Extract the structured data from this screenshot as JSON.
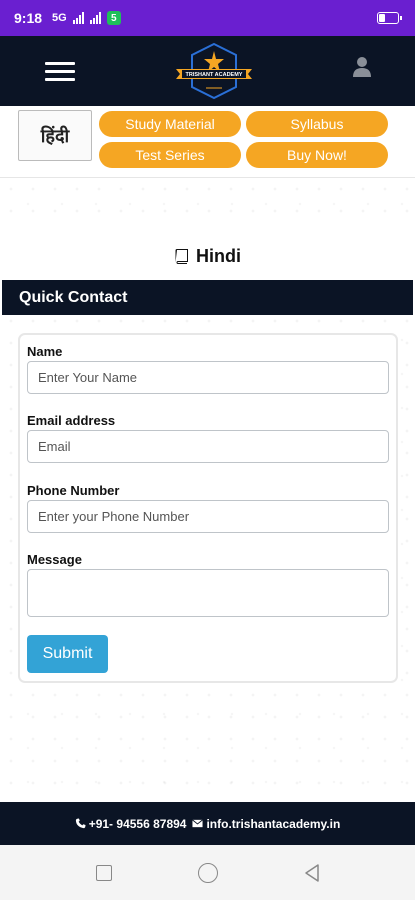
{
  "status_bar": {
    "time": "9:18",
    "carrier": "5G",
    "app_badge": "5",
    "battery_level": 0.3
  },
  "header": {
    "logo_text": "TRISHANT ACADEMY",
    "menu_icon": "hamburger-menu-icon",
    "user_icon": "user-icon"
  },
  "subnav": {
    "thumbnail_text": "हिंदी",
    "buttons": [
      "Study Material",
      "Syllabus",
      "Test Series",
      "Buy Now!"
    ]
  },
  "page": {
    "title": "Hindi",
    "title_icon": "book-icon"
  },
  "quick_contact": {
    "heading": "Quick Contact",
    "fields": {
      "name": {
        "label": "Name",
        "placeholder": "Enter Your Name"
      },
      "email": {
        "label": "Email address",
        "placeholder": "Email"
      },
      "phone": {
        "label": "Phone Number",
        "placeholder": "Enter your Phone Number"
      },
      "message": {
        "label": "Message",
        "placeholder": ""
      }
    },
    "submit_label": "Submit"
  },
  "footer": {
    "phone": "+91- 94556 87894",
    "email": "info.trishantacademy.in"
  },
  "colors": {
    "status_bar": "#6a1fd0",
    "header": "#0b1425",
    "accent_orange": "#f5a623",
    "submit_blue": "#33a3d6"
  }
}
